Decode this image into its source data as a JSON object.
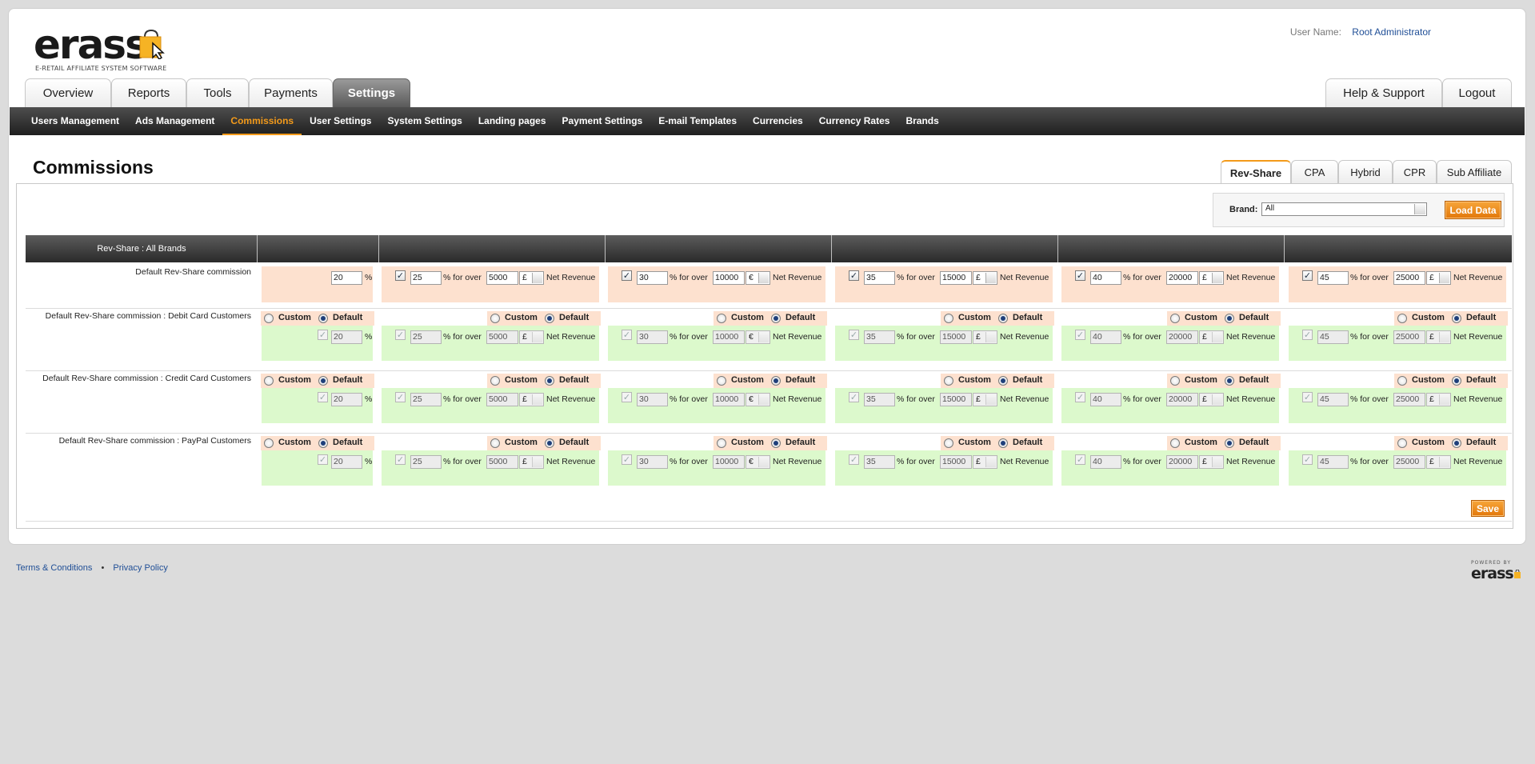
{
  "brand": {
    "logo": "erass",
    "tagline": "E-RETAIL AFFILIATE SYSTEM SOFTWARE",
    "accent": "#f39a1a"
  },
  "user": {
    "label": "User Name:",
    "name": "Root Administrator"
  },
  "main_tabs": [
    {
      "label": "Overview"
    },
    {
      "label": "Reports"
    },
    {
      "label": "Tools"
    },
    {
      "label": "Payments"
    },
    {
      "label": "Settings",
      "active": true
    }
  ],
  "right_tabs": [
    {
      "label": "Help & Support"
    },
    {
      "label": "Logout"
    }
  ],
  "subnav": [
    {
      "label": "Users Management"
    },
    {
      "label": "Ads Management"
    },
    {
      "label": "Commissions",
      "active": true
    },
    {
      "label": "User Settings"
    },
    {
      "label": "System Settings"
    },
    {
      "label": "Landing pages"
    },
    {
      "label": "Payment Settings"
    },
    {
      "label": "E-mail Templates"
    },
    {
      "label": "Currencies"
    },
    {
      "label": "Currency Rates"
    },
    {
      "label": "Brands"
    }
  ],
  "page_title": "Commissions",
  "type_tabs": [
    {
      "label": "Rev-Share",
      "active": true
    },
    {
      "label": "CPA"
    },
    {
      "label": "Hybrid"
    },
    {
      "label": "CPR"
    },
    {
      "label": "Sub Affiliate"
    }
  ],
  "brand_filter": {
    "label": "Brand:",
    "value": "All",
    "button": "Load Data"
  },
  "grid": {
    "header": "Rev-Share : All Brands",
    "text": {
      "percent": "%",
      "for_over": "% for over",
      "net_revenue": "Net Revenue",
      "custom": "Custom",
      "default": "Default",
      "check": "✓"
    },
    "tiers": [
      {
        "pct": "20",
        "over": "",
        "currency": ""
      },
      {
        "pct": "25",
        "over": "5000",
        "currency": "£"
      },
      {
        "pct": "30",
        "over": "10000",
        "currency": "€"
      },
      {
        "pct": "35",
        "over": "15000",
        "currency": "£"
      },
      {
        "pct": "40",
        "over": "20000",
        "currency": "£"
      },
      {
        "pct": "45",
        "over": "25000",
        "currency": "£"
      }
    ],
    "rows": [
      {
        "label": "Default Rev-Share commission",
        "editable": true
      },
      {
        "label": "Default Rev-Share commission : Debit Card Customers",
        "editable": false
      },
      {
        "label": "Default Rev-Share commission : Credit Card Customers",
        "editable": false
      },
      {
        "label": "Default Rev-Share commission : PayPal Customers",
        "editable": false
      }
    ]
  },
  "save_label": "Save",
  "footer": {
    "terms": "Terms & Conditions",
    "bullet": "•",
    "privacy": "Privacy Policy",
    "powered_by": "POWERED BY",
    "powered_logo": "erass"
  }
}
